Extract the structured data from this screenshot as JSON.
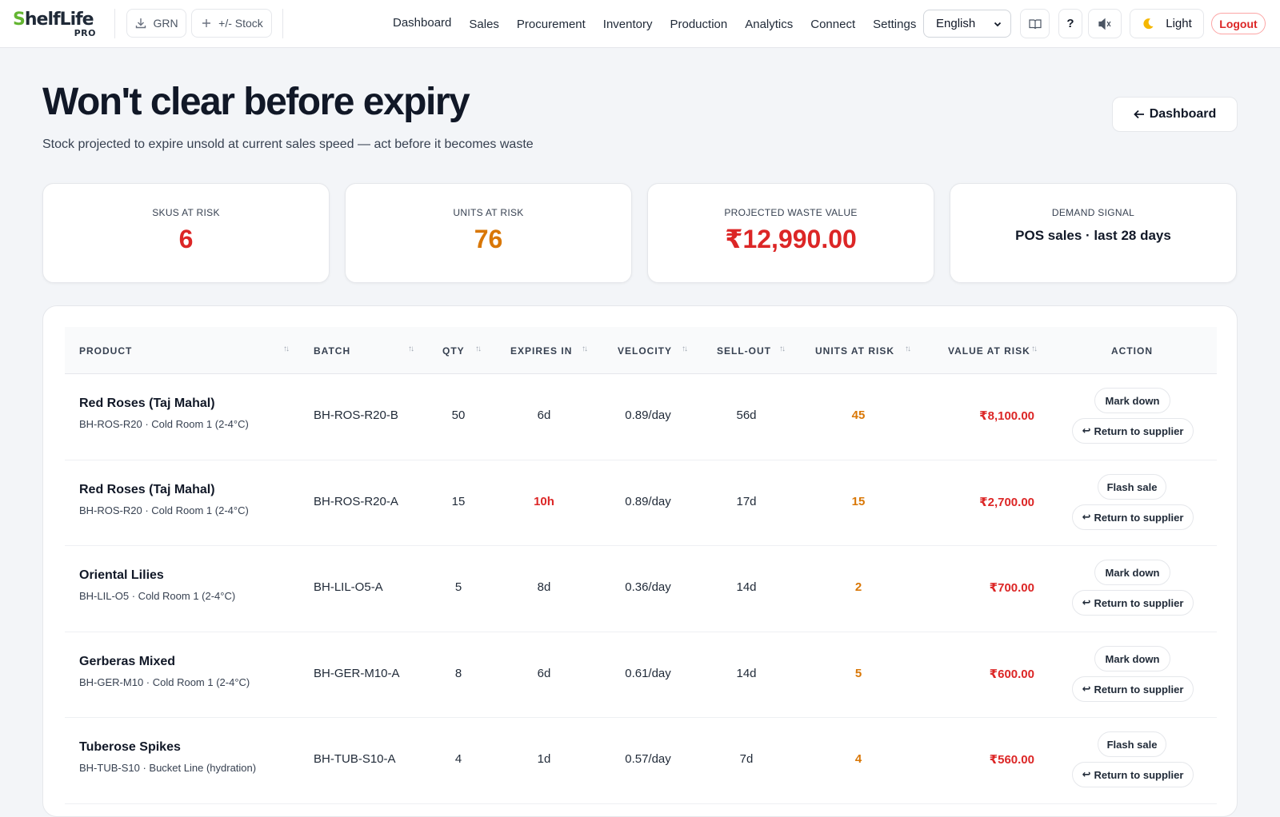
{
  "app": {
    "logo_main": "ShelfLife",
    "logo_badge": "PRO"
  },
  "toolbar": {
    "grn_label": "GRN",
    "stock_label": "+/- Stock",
    "language": "English",
    "help_label": "?",
    "theme_label": "Light",
    "logout_label": "Logout"
  },
  "nav": [
    "Dashboard",
    "Sales",
    "Procurement",
    "Inventory",
    "Production",
    "Analytics",
    "Connect",
    "Settings"
  ],
  "header": {
    "title": "Won't clear before expiry",
    "subtitle": "Stock projected to expire unsold at current sales speed — act before it becomes waste",
    "back_label": "Dashboard"
  },
  "stats": [
    {
      "label": "SKUS AT RISK",
      "value": "6",
      "color": "#dc2626"
    },
    {
      "label": "UNITS AT RISK",
      "value": "76",
      "color": "#d97706"
    },
    {
      "label": "PROJECTED WASTE VALUE",
      "value": "₹12,990.00",
      "color": "#dc2626"
    },
    {
      "label": "DEMAND SIGNAL",
      "value": "POS sales · last 28 days",
      "color": "#111827"
    }
  ],
  "table": {
    "columns": [
      "PRODUCT",
      "BATCH",
      "QTY",
      "EXPIRES IN",
      "VELOCITY",
      "SELL-OUT",
      "UNITS AT RISK",
      "VALUE AT RISK",
      "ACTION"
    ],
    "rows": [
      {
        "product": "Red Roses (Taj Mahal)",
        "sku_location": "BH-ROS-R20 · Cold Room 1 (2-4°C)",
        "batch": "BH-ROS-R20-B",
        "qty": "50",
        "expires_in": "6d",
        "expires_urgent": false,
        "velocity": "0.89/day",
        "sell_out": "56d",
        "units_at_risk": "45",
        "value_at_risk": "₹8,100.00",
        "primary_action": "Mark down",
        "secondary_action": "Return to supplier"
      },
      {
        "product": "Red Roses (Taj Mahal)",
        "sku_location": "BH-ROS-R20 · Cold Room 1 (2-4°C)",
        "batch": "BH-ROS-R20-A",
        "qty": "15",
        "expires_in": "10h",
        "expires_urgent": true,
        "velocity": "0.89/day",
        "sell_out": "17d",
        "units_at_risk": "15",
        "value_at_risk": "₹2,700.00",
        "primary_action": "Flash sale",
        "secondary_action": "Return to supplier"
      },
      {
        "product": "Oriental Lilies",
        "sku_location": "BH-LIL-O5 · Cold Room 1 (2-4°C)",
        "batch": "BH-LIL-O5-A",
        "qty": "5",
        "expires_in": "8d",
        "expires_urgent": false,
        "velocity": "0.36/day",
        "sell_out": "14d",
        "units_at_risk": "2",
        "value_at_risk": "₹700.00",
        "primary_action": "Mark down",
        "secondary_action": "Return to supplier"
      },
      {
        "product": "Gerberas Mixed",
        "sku_location": "BH-GER-M10 · Cold Room 1 (2-4°C)",
        "batch": "BH-GER-M10-A",
        "qty": "8",
        "expires_in": "6d",
        "expires_urgent": false,
        "velocity": "0.61/day",
        "sell_out": "14d",
        "units_at_risk": "5",
        "value_at_risk": "₹600.00",
        "primary_action": "Mark down",
        "secondary_action": "Return to supplier"
      },
      {
        "product": "Tuberose Spikes",
        "sku_location": "BH-TUB-S10 · Bucket Line (hydration)",
        "batch": "BH-TUB-S10-A",
        "qty": "4",
        "expires_in": "1d",
        "expires_urgent": false,
        "velocity": "0.57/day",
        "sell_out": "7d",
        "units_at_risk": "4",
        "value_at_risk": "₹560.00",
        "primary_action": "Flash sale",
        "secondary_action": "Return to supplier"
      }
    ]
  },
  "icons": {
    "download": "download-icon",
    "plus": "plus-icon",
    "chevron": "chevron-down-icon",
    "book": "book-icon",
    "sound": "speaker-muted-icon",
    "moon": "moon-icon",
    "back": "arrow-left-icon",
    "return": "return-arrow-icon",
    "sort": "sort-icon"
  },
  "colors": {
    "brand_green": "#63b531",
    "danger": "#dc2626",
    "warning": "#d97706"
  }
}
